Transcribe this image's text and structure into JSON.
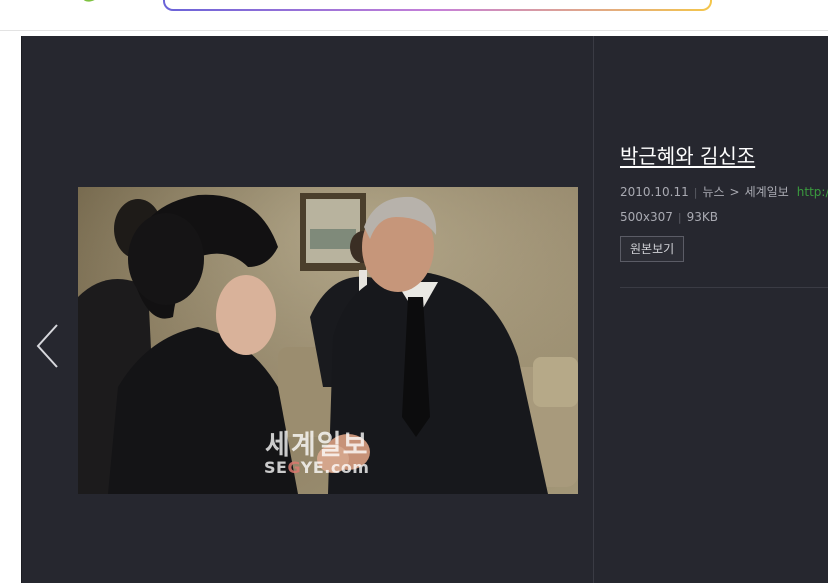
{
  "header": {
    "search_placeholder": ""
  },
  "viewer": {
    "prev_label": "",
    "photo": {
      "watermark_kr": "세계일보",
      "watermark_en_a": "SE",
      "watermark_en_b": "G",
      "watermark_en_c": "YE.com"
    },
    "info": {
      "title": "박근혜와 김신조",
      "date": "2010.10.11",
      "category": "뉴스",
      "arrow": ">",
      "source": "세계일보",
      "url": "http://v",
      "dimensions": "500x307",
      "filesize": "93KB",
      "original_button": "원본보기"
    }
  },
  "colors": {
    "viewer_bg": "#26272f",
    "meta_text": "#a9aab2",
    "url_green": "#3a9a3e"
  },
  "icons": {
    "prev": "chevron-left-icon"
  }
}
